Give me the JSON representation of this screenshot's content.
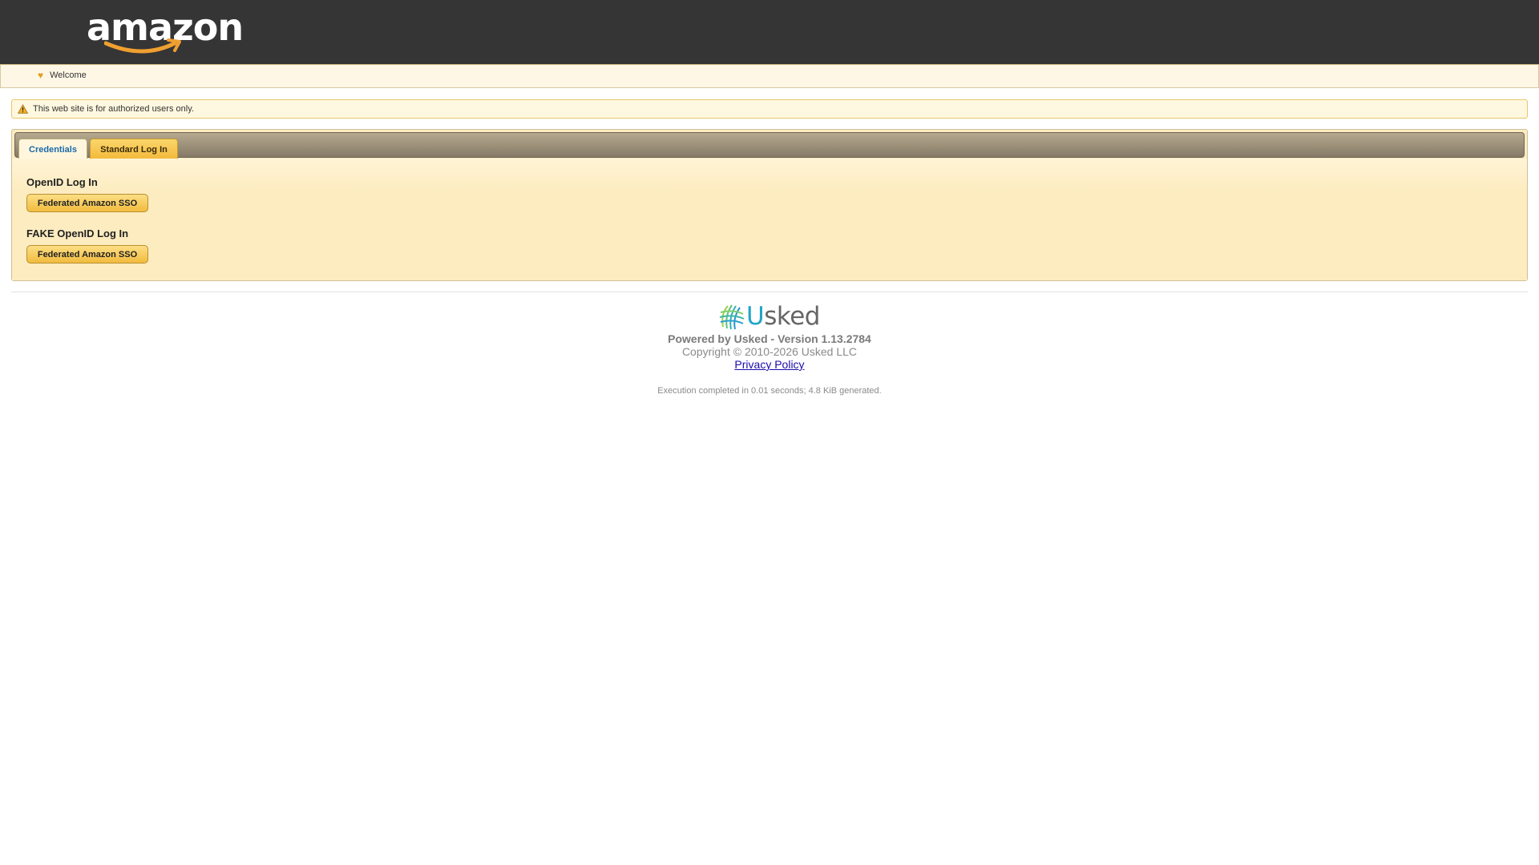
{
  "header": {
    "logo_text": "amazon"
  },
  "nav": {
    "welcome_label": "Welcome"
  },
  "notice": {
    "text": "This web site is for authorized users only."
  },
  "tabs": [
    {
      "label": "Credentials",
      "active": true
    },
    {
      "label": "Standard Log In",
      "active": false
    }
  ],
  "login": {
    "openid_title": "OpenID Log In",
    "openid_button": "Federated Amazon SSO",
    "fake_openid_title": "FAKE OpenID Log In",
    "fake_openid_button": "Federated Amazon SSO"
  },
  "footer": {
    "logo_first_letter": "U",
    "logo_rest": "sked",
    "powered": "Powered by Usked - Version 1.13.2784",
    "copyright": "Copyright © 2010-2026 Usked LLC",
    "privacy_link": "Privacy Policy",
    "execution": "Execution completed in 0.01 seconds; 4.8 KiB generated."
  },
  "colors": {
    "header_bg": "#353535",
    "brand_orange": "#f0a030",
    "panel_bg": "#fdecc0",
    "button_gold": "#f2bb3e",
    "tab_active_text": "#1a6aa8",
    "link": "#1a0dab"
  },
  "icons": {
    "nav": "heart-icon",
    "notice": "warning-icon"
  }
}
